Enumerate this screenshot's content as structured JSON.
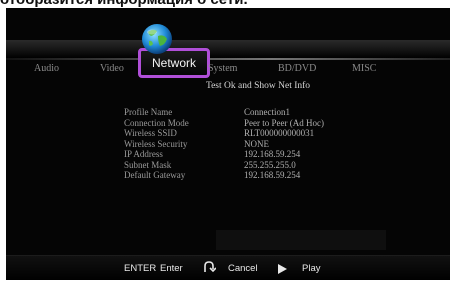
{
  "caption": "отобразится информация о сети.",
  "menu": {
    "tabs": [
      {
        "label": "Audio"
      },
      {
        "label": "Video"
      },
      {
        "label": "Network"
      },
      {
        "label": "System"
      },
      {
        "label": "BD/DVD"
      },
      {
        "label": "MISC"
      }
    ],
    "active_tab": "Network"
  },
  "network": {
    "status_line": "Test Ok and Show Net Info",
    "labels": [
      "Profile Name",
      "Connection Mode",
      "Wireless SSID",
      "Wireless Security",
      "IP Address",
      "Subnet Mask",
      "Default Gateway"
    ],
    "values": [
      "Connection1",
      "Peer to Peer (Ad Hoc)",
      "RLT000000000031",
      "NONE",
      "192.168.59.254",
      "255.255.255.0",
      "192.168.59.254"
    ]
  },
  "footer": {
    "enter_key": "ENTER",
    "enter_label": "Enter",
    "return_icon": "return-arrow-icon",
    "cancel_label": "Cancel",
    "play_icon": "play-triangle-icon",
    "play_label": "Play"
  },
  "colors": {
    "accent": "#b04fd8",
    "background": "#050505"
  }
}
